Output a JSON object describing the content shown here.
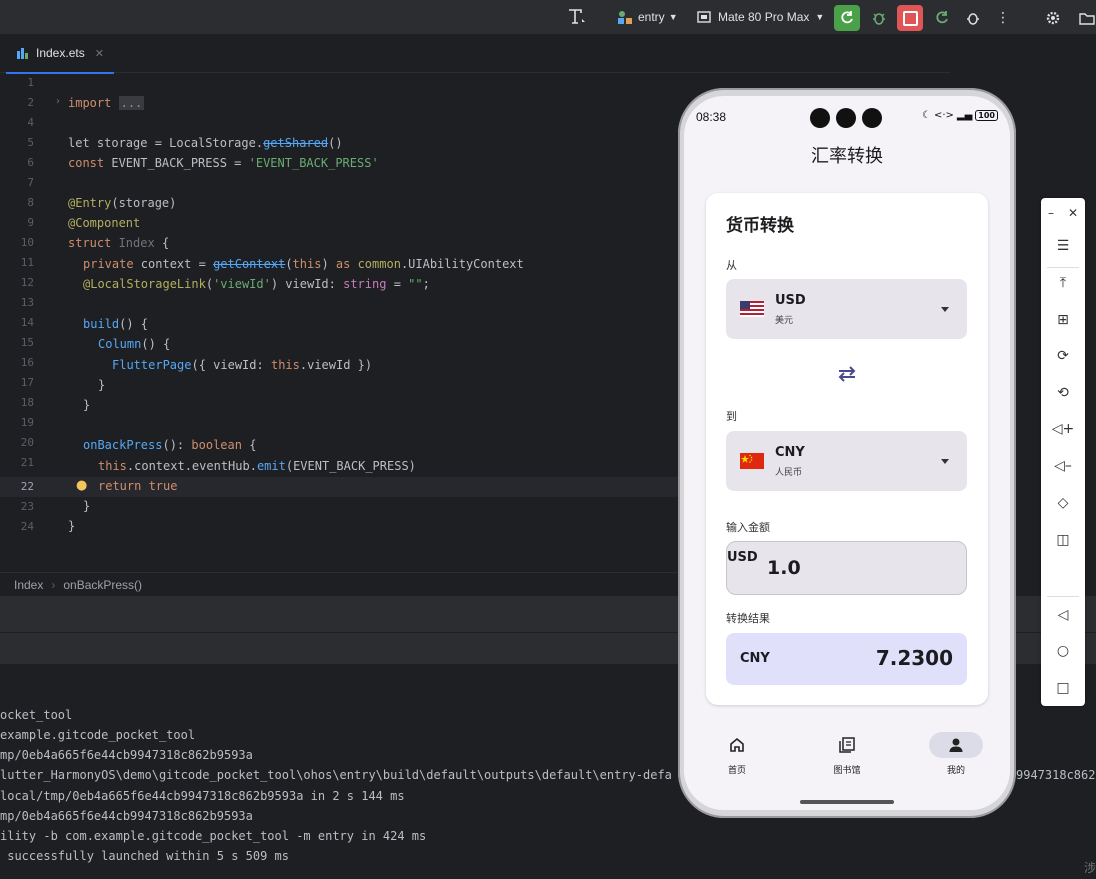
{
  "toolbar": {
    "module": "entry",
    "device": "Mate 80 Pro Max"
  },
  "editor": {
    "tab_label": "Index.ets",
    "lines": [
      {
        "n": "1"
      },
      {
        "n": "2"
      },
      {
        "n": "4"
      },
      {
        "n": "5"
      },
      {
        "n": "6"
      },
      {
        "n": "7"
      },
      {
        "n": "8"
      },
      {
        "n": "9"
      },
      {
        "n": "10"
      },
      {
        "n": "11"
      },
      {
        "n": "12"
      },
      {
        "n": "13"
      },
      {
        "n": "14"
      },
      {
        "n": "15"
      },
      {
        "n": "16"
      },
      {
        "n": "17"
      },
      {
        "n": "18"
      },
      {
        "n": "19"
      },
      {
        "n": "20"
      },
      {
        "n": "21"
      },
      {
        "n": "22"
      },
      {
        "n": "23"
      },
      {
        "n": "24"
      }
    ],
    "code": {
      "l2_kw": "import",
      "l2_fold": "...",
      "l5_a": "let storage = LocalStorage.",
      "l5_b": "getShared",
      "l5_c": "()",
      "l6_kw": "const",
      "l6_a": " EVENT_BACK_PRESS = ",
      "l6_s": "'EVENT_BACK_PRESS'",
      "l8_d": "@Entry",
      "l8_a": "(storage)",
      "l9_d": "@Component",
      "l10_kw": "struct",
      "l10_c": " Index",
      "l10_a": " {",
      "l11_kw": "private",
      "l11_a": " context = ",
      "l11_f": "getContext",
      "l11_b": "(",
      "l11_t": "this",
      "l11_c": ") ",
      "l11_as": "as",
      "l11_m": " common",
      "l11_e": ".UIAbilityContext",
      "l12_d": "@LocalStorageLink",
      "l12_a": "(",
      "l12_s": "'viewId'",
      "l12_b": ") viewId: ",
      "l12_ty": "string",
      "l12_c": " = ",
      "l12_s2": "\"\"",
      "l12_e": ";",
      "l14_f": "build",
      "l14_a": "() {",
      "l15_f": "Column",
      "l15_a": "() {",
      "l16_f": "FlutterPage",
      "l16_a": "({ viewId: ",
      "l16_t": "this",
      "l16_b": ".viewId })",
      "l17": "}",
      "l18": "}",
      "l20_f": "onBackPress",
      "l20_a": "(): ",
      "l20_ty": "boolean",
      "l20_b": " {",
      "l21_t": "this",
      "l21_a": ".context.eventHub.",
      "l21_f": "emit",
      "l21_b": "(EVENT_BACK_PRESS)",
      "l22_kw": "return",
      "l22_v": " true",
      "l23": "}",
      "l24": "}"
    },
    "breadcrumb": [
      "Index",
      "onBackPress()"
    ]
  },
  "console": {
    "lines": [
      "ocket_tool",
      "example.gitcode_pocket_tool",
      "mp/0eb4a665f6e44cb9947318c862b9593a",
      "lutter_HarmonyOS\\demo\\gitcode_pocket_tool\\ohos\\entry\\build\\default\\outputs\\default\\entry-defa",
      "local/tmp/0eb4a665f6e44cb9947318c862b9593a in 2 s 144 ms",
      "mp/0eb4a665f6e44cb9947318c862b9593a",
      "ility -b com.example.gitcode_pocket_tool -m entry in 424 ms",
      " successfully launched within 5 s 509 ms"
    ],
    "overflow_tail": "9947318c862"
  },
  "phone": {
    "time": "08:38",
    "battery": "100",
    "app_title": "汇率转换",
    "card_title": "货币转换",
    "from_label": "从",
    "from_code": "USD",
    "from_name": "美元",
    "to_label": "到",
    "to_code": "CNY",
    "to_name": "人民币",
    "amount_label": "输入金额",
    "amount_prefix": "USD",
    "amount_value": "1.0",
    "result_label": "转换结果",
    "result_code": "CNY",
    "result_value": "7.2300",
    "nav": [
      {
        "label": "首页",
        "icon": "home-icon"
      },
      {
        "label": "图书馆",
        "icon": "library-icon"
      },
      {
        "label": "我的",
        "icon": "person-icon"
      }
    ]
  },
  "colors": {
    "accent": "#3574f0",
    "run_green": "#4aa14a",
    "stop_red": "#e05555",
    "result_bg": "#e0e0fb"
  },
  "corner_glyph": "涉"
}
